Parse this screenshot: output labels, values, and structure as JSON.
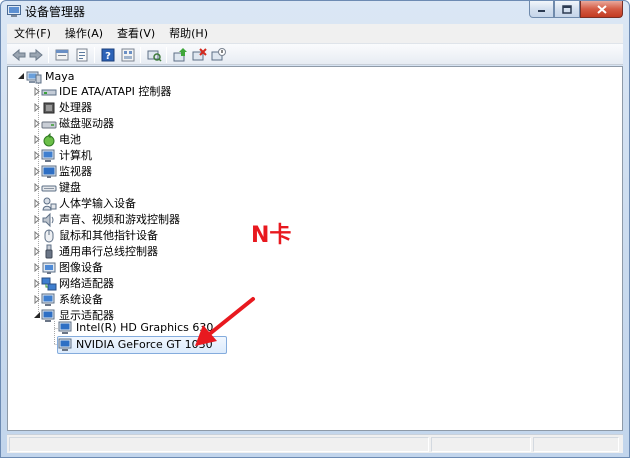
{
  "window": {
    "title": "设备管理器",
    "accent": "#6d8bb3",
    "close_color": "#c23b22"
  },
  "menu": {
    "items": [
      "文件(F)",
      "操作(A)",
      "查看(V)",
      "帮助(H)"
    ]
  },
  "toolbar": {
    "buttons": [
      "back-icon",
      "forward-icon",
      "up-icon",
      "properties-icon",
      "help-icon",
      "view-icon",
      "scan-hardware-icon",
      "update-driver-icon",
      "uninstall-icon",
      "disable-icon"
    ]
  },
  "tree": {
    "root": "Maya",
    "categories": [
      {
        "label": "IDE ATA/ATAPI 控制器",
        "icon": "ide-controller-icon"
      },
      {
        "label": "处理器",
        "icon": "processor-icon"
      },
      {
        "label": "磁盘驱动器",
        "icon": "disk-drive-icon"
      },
      {
        "label": "电池",
        "icon": "battery-icon"
      },
      {
        "label": "计算机",
        "icon": "computer-icon"
      },
      {
        "label": "监视器",
        "icon": "monitor-icon"
      },
      {
        "label": "键盘",
        "icon": "keyboard-icon"
      },
      {
        "label": "人体学输入设备",
        "icon": "hid-icon"
      },
      {
        "label": "声音、视频和游戏控制器",
        "icon": "sound-icon"
      },
      {
        "label": "鼠标和其他指针设备",
        "icon": "mouse-icon"
      },
      {
        "label": "通用串行总线控制器",
        "icon": "usb-icon"
      },
      {
        "label": "图像设备",
        "icon": "imaging-device-icon"
      },
      {
        "label": "网络适配器",
        "icon": "network-adapter-icon"
      },
      {
        "label": "系统设备",
        "icon": "system-device-icon"
      },
      {
        "label": "显示适配器",
        "icon": "display-adapter-icon"
      }
    ],
    "display_children": [
      {
        "label": "Intel(R) HD Graphics 630"
      },
      {
        "label": "NVIDIA GeForce GT 1030"
      }
    ]
  },
  "annotation": {
    "text": "N卡",
    "color": "#e8191f"
  }
}
